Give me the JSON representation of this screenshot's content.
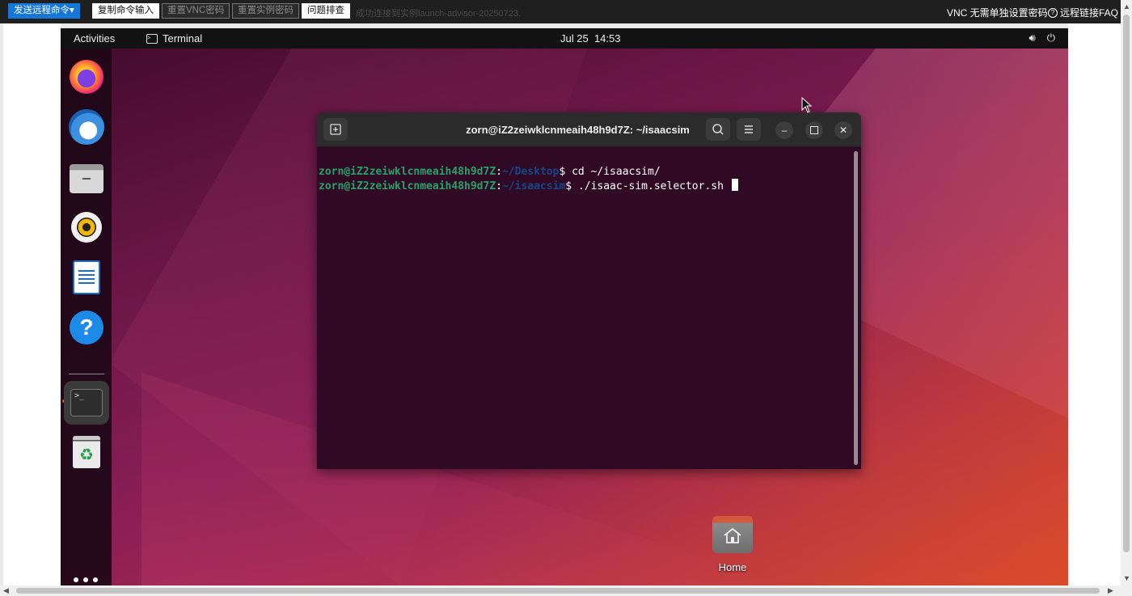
{
  "vnc": {
    "send_cmd": "发送远程命令▾",
    "copy_input": "复制命令输入",
    "reset_vnc": "重置VNC密码",
    "reset_instance": "重置实例密码",
    "troubleshoot": "问题排查",
    "status": "成功连接到实例launch-advisor-20250723.",
    "vnc_password": "VNC 无需单独设置密码",
    "faq": "远程链接FAQ"
  },
  "panel": {
    "activities": "Activities",
    "app_name": "Terminal",
    "date": "Jul 25",
    "time": "14:53"
  },
  "dock": {
    "items": [
      "firefox-icon",
      "thunderbird-icon",
      "files-icon",
      "rhythmbox-icon",
      "writer-icon",
      "help-icon",
      "terminal-icon",
      "trash-icon"
    ],
    "terminal_glyph": ">_"
  },
  "desktop": {
    "home_label": "Home"
  },
  "terminal": {
    "title": "zorn@iZ2zeiwklcnmeaih48h9d7Z: ~/isaacsim",
    "lines": [
      {
        "user": "zorn@iZ2zeiwklcnmeaih48h9d7Z",
        "sep": ":",
        "path": "~/Desktop",
        "cmd": "$ cd ~/isaacsim/"
      },
      {
        "user": "zorn@iZ2zeiwklcnmeaih48h9d7Z",
        "sep": ":",
        "path": "~/isaacsim",
        "cmd": "$ ./isaac-sim.selector.sh "
      }
    ]
  },
  "colors": {
    "terminal_bg": "#300a24",
    "prompt_user": "#26a269",
    "prompt_path": "#12488b",
    "accent": "#e95420"
  }
}
